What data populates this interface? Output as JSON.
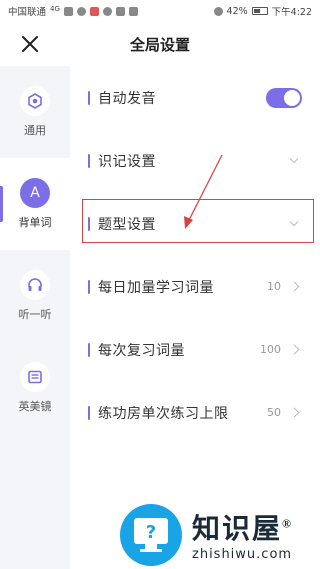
{
  "status_bar": {
    "carrier": "中国联通",
    "network": "4G",
    "battery": "42%",
    "time": "下午4:22"
  },
  "header": {
    "title": "全局设置",
    "close_icon": "close-icon"
  },
  "sidebar": {
    "items": [
      {
        "label": "通用",
        "icon": "hexagon-icon",
        "active": false
      },
      {
        "label": "背单词",
        "icon": "letter-a-icon",
        "icon_glyph": "A",
        "active": true
      },
      {
        "label": "听一听",
        "icon": "headphones-icon",
        "active": false
      },
      {
        "label": "英美镜",
        "icon": "book-icon",
        "active": false
      }
    ]
  },
  "settings": {
    "rows": [
      {
        "label": "自动发音",
        "control": "toggle",
        "toggle_on": true
      },
      {
        "label": "识记设置",
        "control": "chevron-down"
      },
      {
        "label": "题型设置",
        "control": "chevron-down",
        "highlighted": true
      },
      {
        "label": "每日加量学习词量",
        "value": "10",
        "control": "chevron-right"
      },
      {
        "label": "每次复习词量",
        "value": "100",
        "control": "chevron-right"
      },
      {
        "label": "练功房单次练习上限",
        "value": "50",
        "control": "chevron-right"
      }
    ]
  },
  "watermark": {
    "title": "知识屋",
    "registered": "®",
    "url": "zhishiwu.com"
  },
  "colors": {
    "accent": "#7b6ee6",
    "annotation_red": "#d64545",
    "sidebar_bg": "#f4f5f9",
    "watermark_blue": "#19a4e6"
  }
}
